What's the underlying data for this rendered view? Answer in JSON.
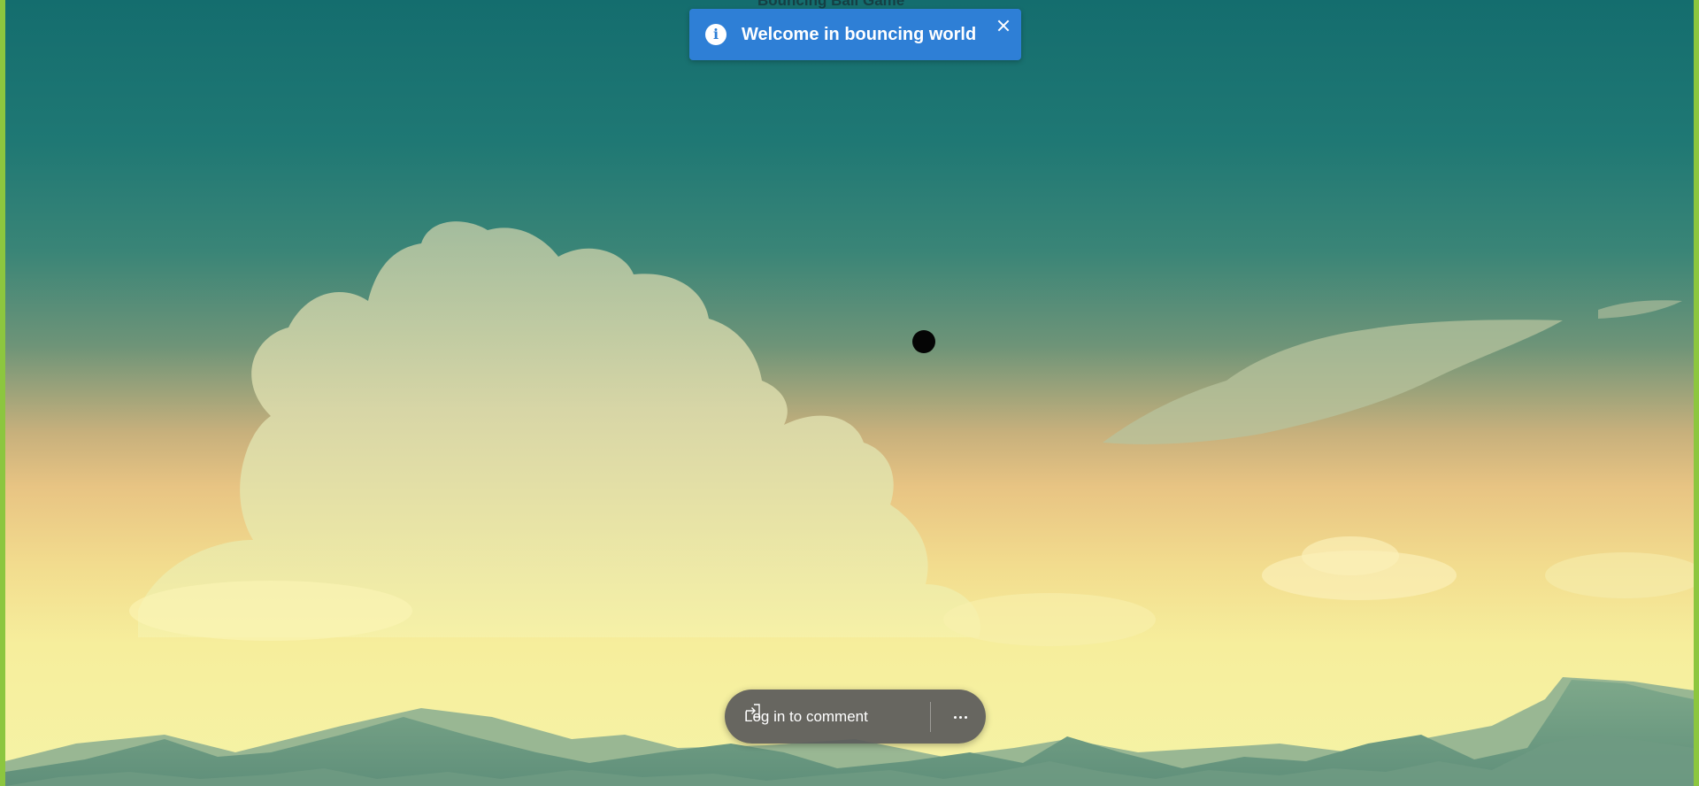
{
  "game": {
    "title": "Bouncing Ball Game"
  },
  "toast": {
    "message": "Welcome in bouncing world",
    "icon": "info-icon",
    "close_icon": "close-icon",
    "color": "#2e7fd6"
  },
  "comment_bar": {
    "login_label": "Log in to comment",
    "login_icon": "sign-in-icon",
    "more_icon": "more-options-icon"
  },
  "colors": {
    "frame_border": "#8cc63f",
    "ball": "#050505"
  }
}
